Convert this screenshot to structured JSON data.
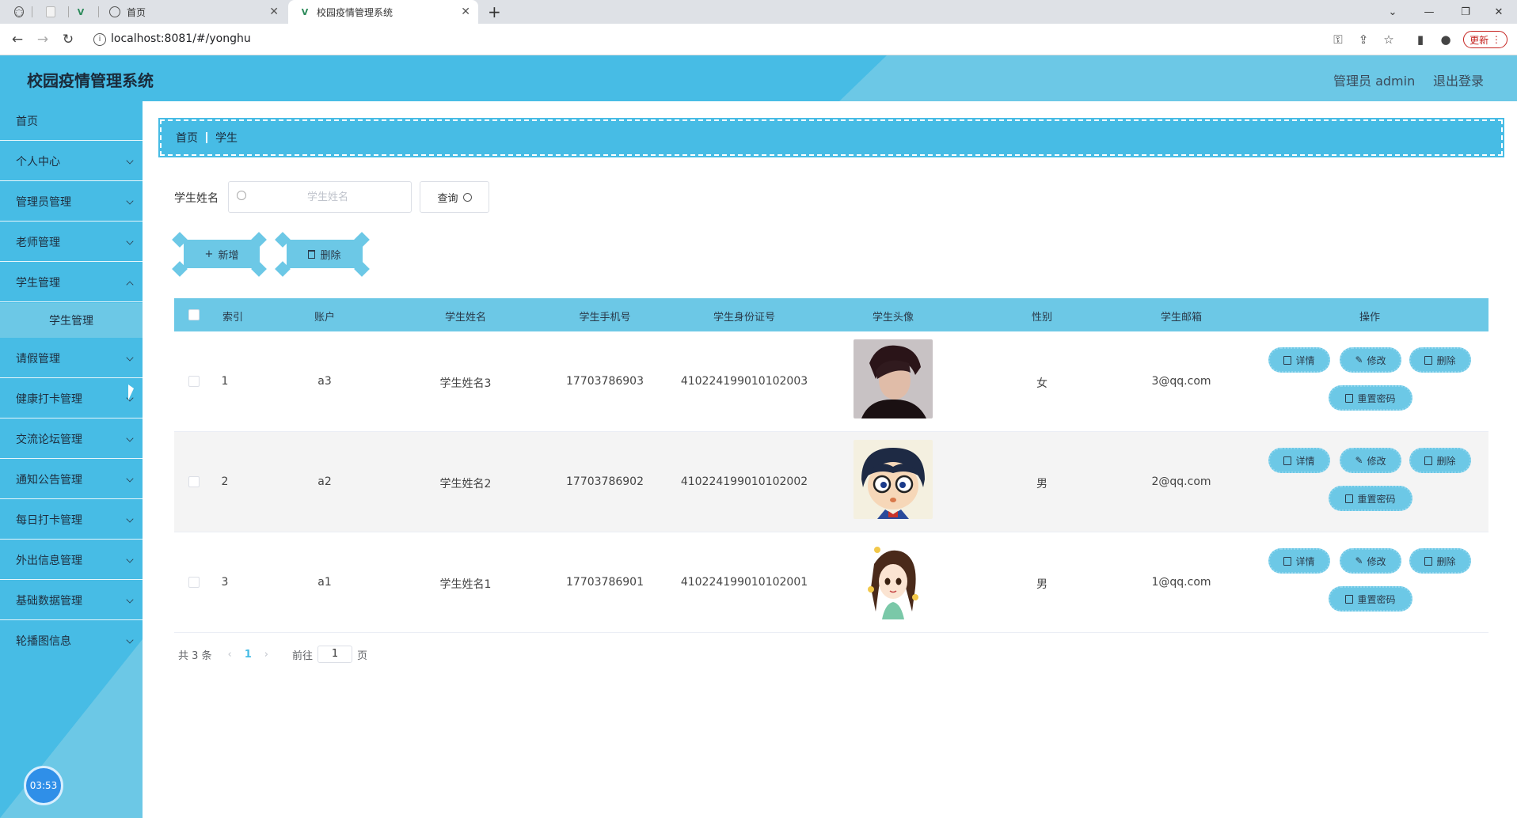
{
  "browser": {
    "tabs": [
      {
        "title": "首页"
      },
      {
        "title": "校园疫情管理系统"
      }
    ],
    "new_tab": "+",
    "url": "localhost:8081/#/yonghu",
    "update_label": "更新"
  },
  "header": {
    "title": "校园疫情管理系统",
    "admin": "管理员 admin",
    "logout": "退出登录"
  },
  "sidebar": {
    "items": [
      {
        "label": "首页"
      },
      {
        "label": "个人中心"
      },
      {
        "label": "管理员管理"
      },
      {
        "label": "老师管理"
      },
      {
        "label": "学生管理"
      },
      {
        "label": "请假管理"
      },
      {
        "label": "健康打卡管理"
      },
      {
        "label": "交流论坛管理"
      },
      {
        "label": "通知公告管理"
      },
      {
        "label": "每日打卡管理"
      },
      {
        "label": "外出信息管理"
      },
      {
        "label": "基础数据管理"
      },
      {
        "label": "轮播图信息"
      }
    ],
    "sub_item": "学生管理",
    "clock": "03:53"
  },
  "breadcrumb": {
    "home": "首页",
    "current": "学生"
  },
  "search": {
    "label": "学生姓名",
    "placeholder": "学生姓名",
    "query_label": "查询"
  },
  "actions": {
    "add_label": "新增",
    "delete_label": "删除"
  },
  "table": {
    "headers": [
      "索引",
      "账户",
      "学生姓名",
      "学生手机号",
      "学生身份证号",
      "学生头像",
      "性别",
      "学生邮箱",
      "操作"
    ],
    "rows": [
      {
        "index": "1",
        "account": "a3",
        "name": "学生姓名3",
        "phone": "17703786903",
        "id_card": "410224199010102003",
        "gender": "女",
        "email": "3@qq.com"
      },
      {
        "index": "2",
        "account": "a2",
        "name": "学生姓名2",
        "phone": "17703786902",
        "id_card": "410224199010102002",
        "gender": "男",
        "email": "2@qq.com"
      },
      {
        "index": "3",
        "account": "a1",
        "name": "学生姓名1",
        "phone": "17703786901",
        "id_card": "410224199010102001",
        "gender": "男",
        "email": "1@qq.com"
      }
    ],
    "ops": {
      "detail": "详情",
      "edit": "修改",
      "delete": "删除",
      "reset": "重置密码"
    }
  },
  "pagination": {
    "total": "共 3 条",
    "current_page": "1",
    "goto_prefix": "前往",
    "goto_value": "1",
    "goto_suffix": "页"
  }
}
